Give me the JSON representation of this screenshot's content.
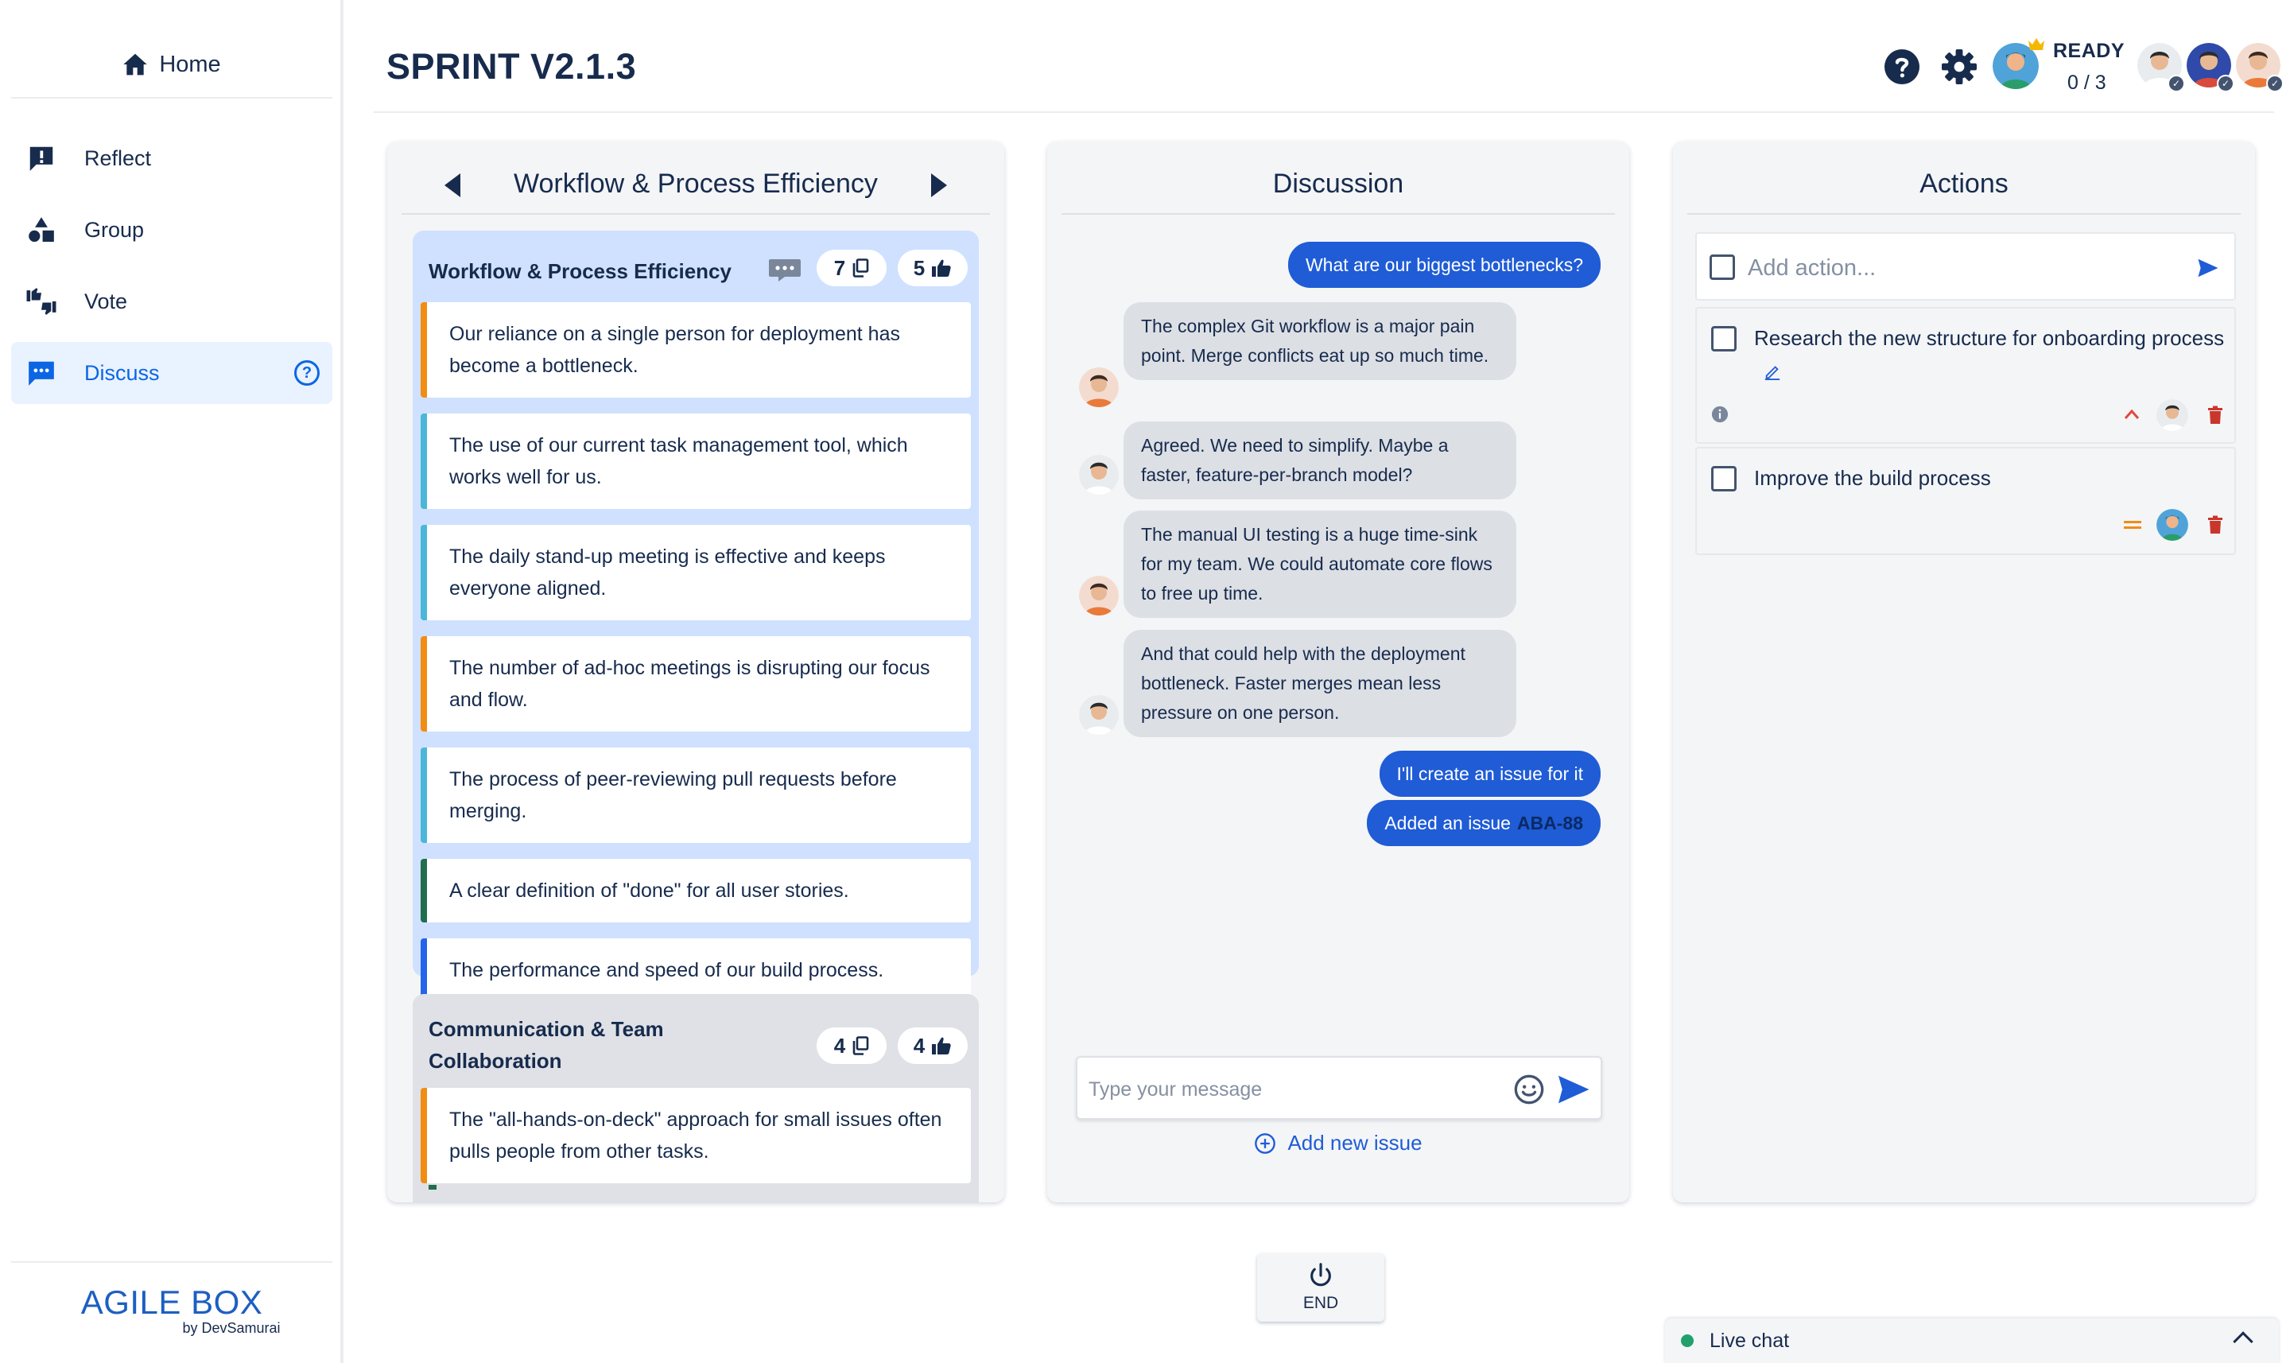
{
  "sidebar": {
    "home_label": "Home",
    "items": [
      {
        "label": "Reflect",
        "icon": "exclamation-icon"
      },
      {
        "label": "Group",
        "icon": "shapes-icon"
      },
      {
        "label": "Vote",
        "icon": "thumbs-icon"
      },
      {
        "label": "Discuss",
        "icon": "chat-icon",
        "active": true
      }
    ],
    "help_glyph": "?",
    "brand": {
      "name": "AGILE BOX",
      "by": "by DevSamurai"
    }
  },
  "header": {
    "title": "SPRINT V2.1.3",
    "ready_label": "READY",
    "ready_count": "0 / 3"
  },
  "groups_panel": {
    "title": "Workflow & Process Efficiency",
    "groups": [
      {
        "name": "Workflow & Process Efficiency",
        "card_count": "7",
        "vote_count": "5",
        "notes": [
          {
            "text": "Our reliance on a single person for deployment has become a bottleneck.",
            "color": "orange"
          },
          {
            "text": "The use of our current task management tool, which works well for us.",
            "color": "teal"
          },
          {
            "text": "The daily stand-up meeting is effective and keeps everyone aligned.",
            "color": "teal"
          },
          {
            "text": "The number of ad-hoc meetings is disrupting our focus and flow.",
            "color": "orange"
          },
          {
            "text": "The process of peer-reviewing pull requests before merging.",
            "color": "teal"
          },
          {
            "text": "A clear definition of \"done\" for all user stories.",
            "color": "green"
          },
          {
            "text": "The performance and speed of our build process.",
            "color": "blue"
          }
        ]
      },
      {
        "name": "Communication & Team Collaboration",
        "card_count": "4",
        "vote_count": "4",
        "notes": [
          {
            "text": "The \"all-hands-on-deck\" approach for small issues often pulls people from other tasks.",
            "color": "orange"
          }
        ]
      }
    ]
  },
  "discussion": {
    "title": "Discussion",
    "messages": [
      {
        "text": "What are our biggest bottlenecks?",
        "outgoing": true
      },
      {
        "text": "The complex Git workflow is a major pain point. Merge conflicts eat up so much time.",
        "outgoing": false
      },
      {
        "text": "Agreed. We need to simplify. Maybe a faster, feature-per-branch model?",
        "outgoing": false
      },
      {
        "text": "The manual UI testing is a huge time-sink for my team. We could automate core flows to free up time.",
        "outgoing": false
      },
      {
        "text": "And that could help with the deployment bottleneck. Faster merges mean less pressure on one person.",
        "outgoing": false
      },
      {
        "text": "I'll create an issue for it",
        "outgoing": true
      },
      {
        "text": "Added an issue",
        "issue_key": "ABA-88",
        "outgoing": true
      }
    ],
    "input_placeholder": "Type your message",
    "add_issue_label": "Add new issue"
  },
  "actions": {
    "title": "Actions",
    "input_placeholder": "Add action...",
    "items": [
      {
        "text": "Research the new structure for onboarding process",
        "priority": "high"
      },
      {
        "text": "Improve the build process",
        "priority": "medium"
      }
    ]
  },
  "end_button_label": "END",
  "live_chat_label": "Live chat",
  "colors": {
    "primary": "#1f5cd6",
    "note_orange": "#f18d13",
    "note_teal": "#4bb6d8",
    "note_green": "#216e4e",
    "note_blue": "#2563eb",
    "danger": "#c9372c"
  }
}
